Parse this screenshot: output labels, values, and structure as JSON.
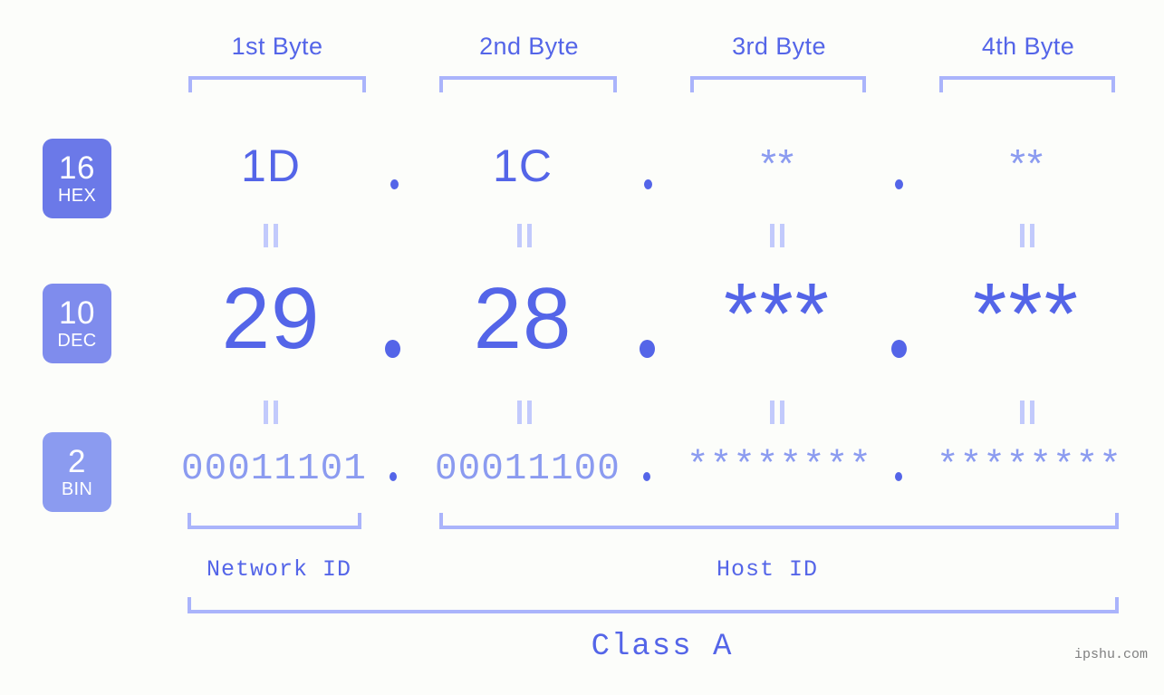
{
  "meta": {
    "background": "#fcfdfa",
    "accent": "#5465e8",
    "accent_light": "#8b9bf0",
    "bracket_color": "#aab4fb"
  },
  "columns": [
    {
      "header": "1st Byte"
    },
    {
      "header": "2nd Byte"
    },
    {
      "header": "3rd Byte"
    },
    {
      "header": "4th Byte"
    }
  ],
  "rows": {
    "hex": {
      "badge_number": "16",
      "badge_name": "HEX",
      "badge_color": "#6b79e8",
      "values": [
        "1D",
        "1C",
        "**",
        "**"
      ]
    },
    "dec": {
      "badge_number": "10",
      "badge_name": "DEC",
      "badge_color": "#7f8ced",
      "values": [
        "29",
        "28",
        "***",
        "***"
      ]
    },
    "bin": {
      "badge_number": "2",
      "badge_name": "BIN",
      "badge_color": "#8b9bf0",
      "values": [
        "00011101",
        "00011100",
        "********",
        "********"
      ]
    }
  },
  "separator": ".",
  "equals_mark": "=",
  "footer": {
    "network_id_label": "Network ID",
    "host_id_label": "Host ID",
    "class_label": "Class A",
    "watermark": "ipshu.com"
  }
}
